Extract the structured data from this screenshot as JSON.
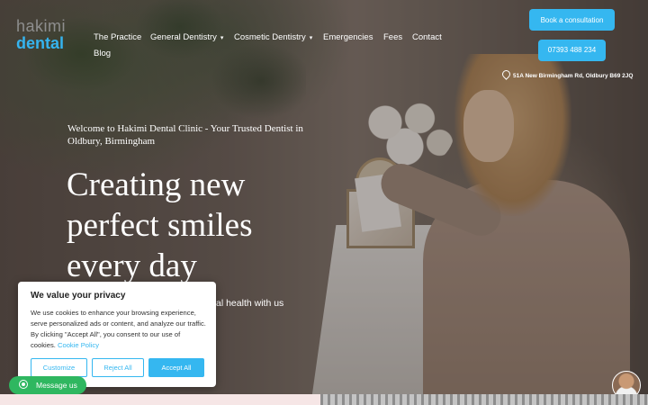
{
  "brand": {
    "logo_line1": "hakimi",
    "logo_line2": "dental"
  },
  "nav": {
    "items": [
      {
        "label": "The Practice"
      },
      {
        "label": "General Dentistry",
        "caret": "▾"
      },
      {
        "label": "Cosmetic Dentistry",
        "caret": "▾"
      },
      {
        "label": "Emergencies"
      },
      {
        "label": "Fees"
      },
      {
        "label": "Contact"
      },
      {
        "label": "Blog"
      }
    ]
  },
  "header": {
    "book_button": "Book a consultation",
    "phone_button": "07393 488 234",
    "address": "51A New Birmingham Rd, Oldbury B69 2JQ"
  },
  "hero": {
    "tagline": "Welcome to Hakimi Dental Clinic - Your Trusted Dentist in Oldbury, Birmingham",
    "headline": "Creating new perfect smiles every day",
    "subtext_visible": "al health with us"
  },
  "cookie": {
    "title": "We value your privacy",
    "text": "We use cookies to enhance your browsing experience, serve personalized ads or content, and analyze our traffic. By clicking \"Accept All\", you consent to our use of cookies.",
    "policy_link": "Cookie Policy",
    "customize": "Customize",
    "reject": "Reject All",
    "accept": "Accept All"
  },
  "whatsapp": {
    "label": "Message us"
  },
  "colors": {
    "accent": "#35b7f0",
    "whatsapp": "#2fb760"
  }
}
